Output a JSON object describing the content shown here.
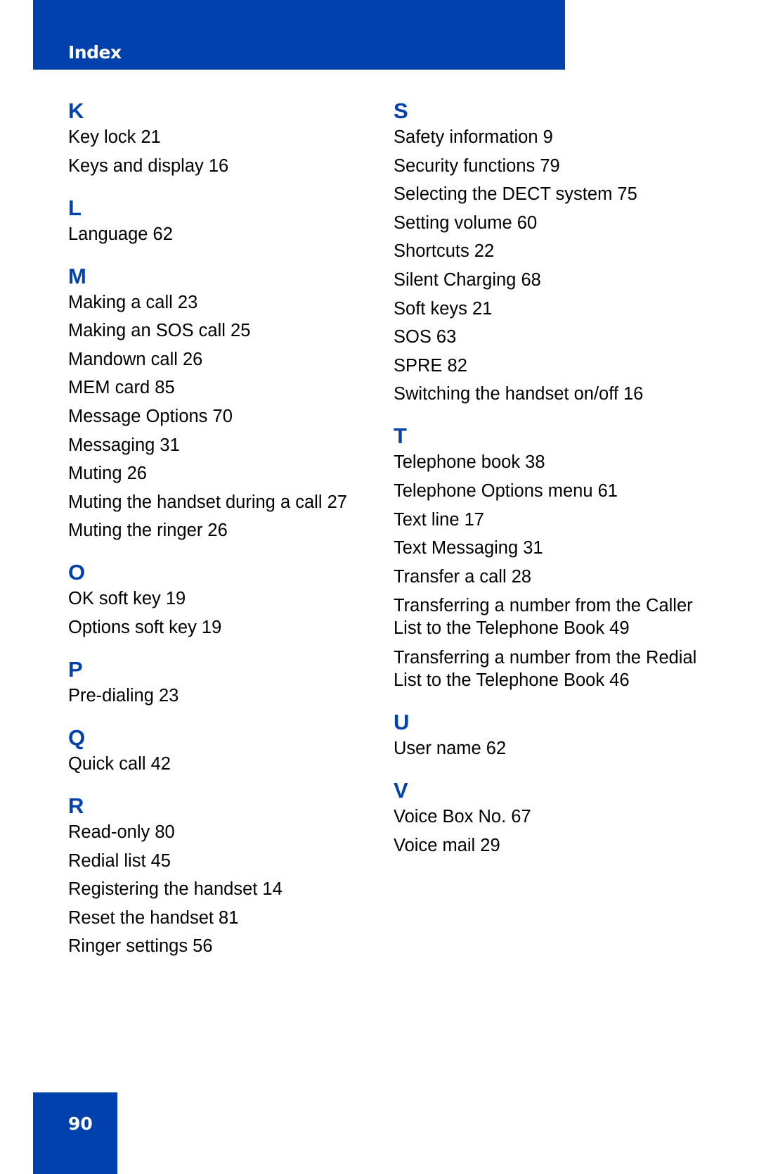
{
  "header": {
    "title": "Index"
  },
  "footer": {
    "page_number": "90"
  },
  "colors": {
    "accent": "#0041ad"
  },
  "columns": [
    {
      "sections": [
        {
          "letter": "K",
          "entries": [
            "Key lock 21",
            "Keys and display 16"
          ]
        },
        {
          "letter": "L",
          "entries": [
            "Language 62"
          ]
        },
        {
          "letter": "M",
          "entries": [
            "Making a call 23",
            "Making an SOS call 25",
            "Mandown call 26",
            "MEM card 85",
            "Message Options 70",
            "Messaging 31",
            "Muting 26",
            "Muting the handset during a call 27",
            "Muting the ringer 26"
          ]
        },
        {
          "letter": "O",
          "entries": [
            "OK soft key 19",
            "Options soft key 19"
          ]
        },
        {
          "letter": "P",
          "entries": [
            "Pre-dialing 23"
          ]
        },
        {
          "letter": "Q",
          "entries": [
            "Quick call 42"
          ]
        },
        {
          "letter": "R",
          "entries": [
            "Read-only 80",
            "Redial list 45",
            "Registering the handset 14",
            "Reset the handset 81",
            "Ringer settings 56"
          ]
        }
      ]
    },
    {
      "sections": [
        {
          "letter": "S",
          "entries": [
            "Safety information 9",
            "Security functions 79",
            "Selecting the DECT system 75",
            "Setting volume 60",
            "Shortcuts 22",
            "Silent Charging 68",
            "Soft keys 21",
            "SOS 63",
            "SPRE 82",
            "Switching the handset on/off 16"
          ]
        },
        {
          "letter": "T",
          "entries": [
            "Telephone book 38",
            "Telephone Options menu 61",
            "Text line 17",
            "Text Messaging 31",
            "Transfer a call 28",
            "Transferring a number from the Caller List to the Telephone Book 49",
            "Transferring a number from the Redial List to the Telephone Book 46"
          ]
        },
        {
          "letter": "U",
          "entries": [
            "User name 62"
          ]
        },
        {
          "letter": "V",
          "entries": [
            "Voice Box No. 67",
            "Voice mail 29"
          ]
        }
      ]
    }
  ]
}
